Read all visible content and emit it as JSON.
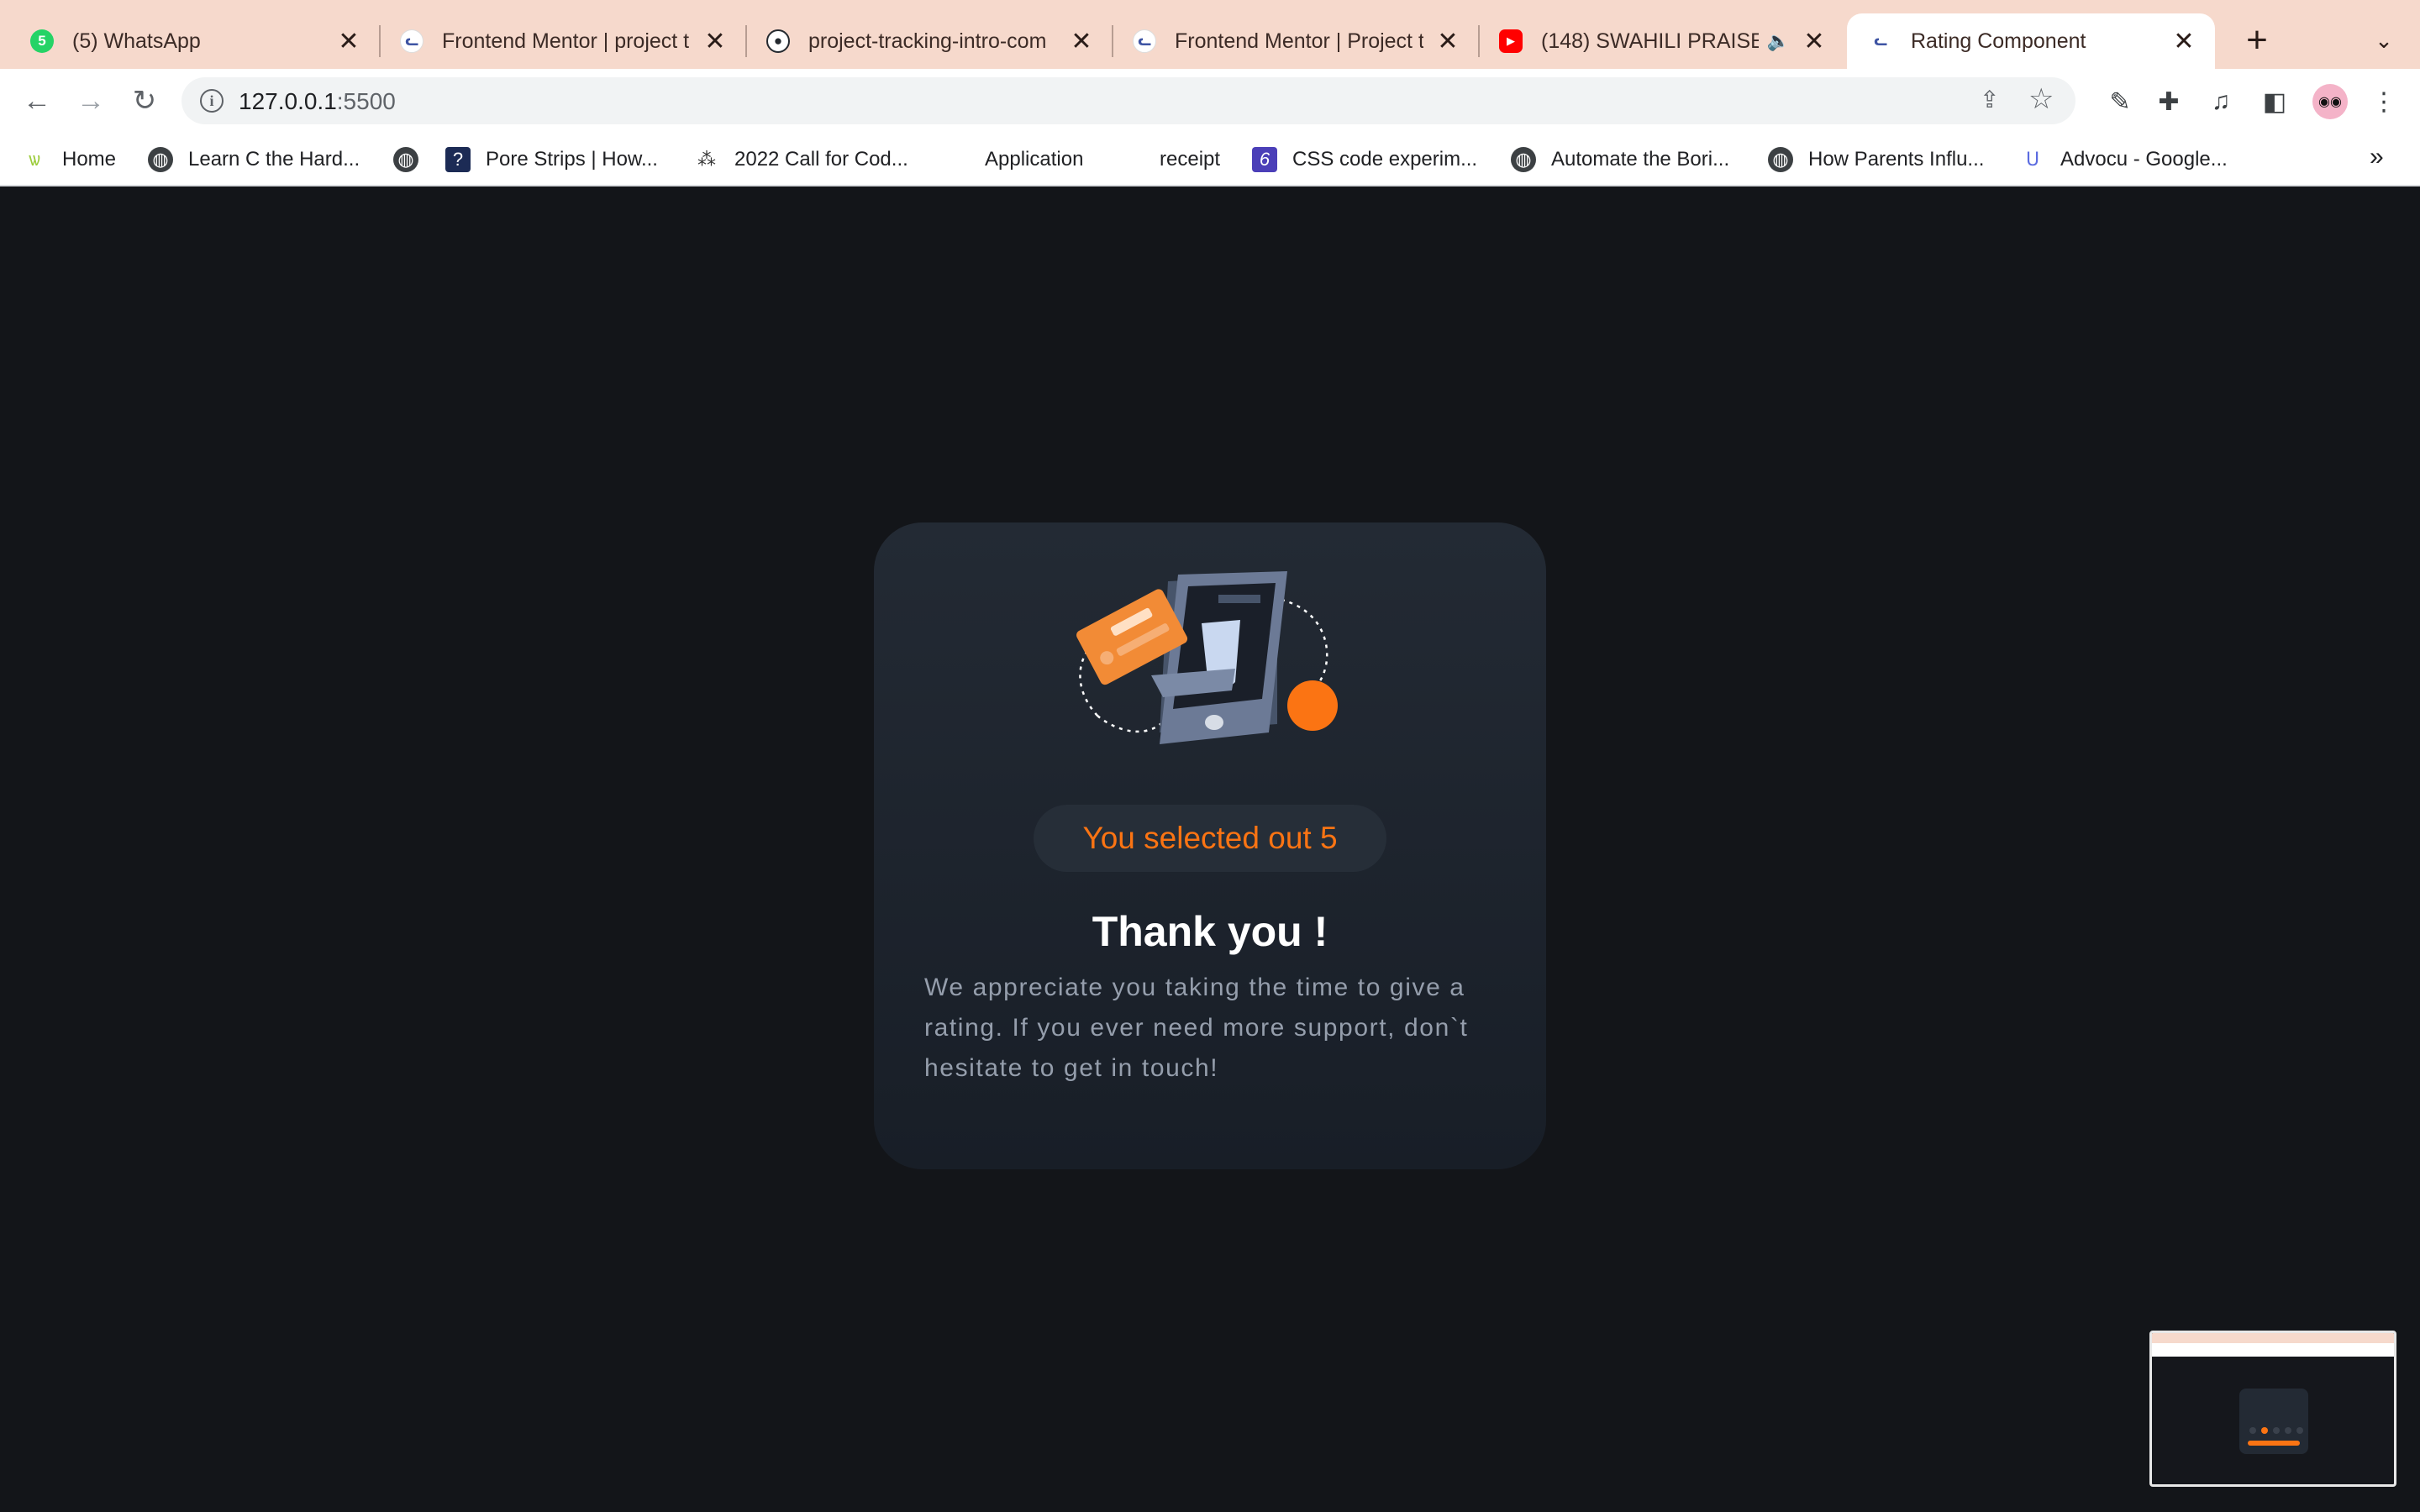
{
  "browser": {
    "tabs": [
      {
        "title": "(5) WhatsApp",
        "favicon": "whatsapp-icon",
        "badge": "5",
        "active": false
      },
      {
        "title": "Frontend Mentor | project t",
        "favicon": "frontend-mentor-icon",
        "active": false
      },
      {
        "title": "project-tracking-intro-com",
        "favicon": "github-icon",
        "active": false
      },
      {
        "title": "Frontend Mentor | Project t",
        "favicon": "frontend-mentor-icon",
        "active": false
      },
      {
        "title": "(148) SWAHILI PRAISE",
        "favicon": "youtube-icon",
        "muted_indicator": "speaker-icon",
        "active": false
      },
      {
        "title": "Rating Component",
        "favicon": "frontend-mentor-icon",
        "active": true
      }
    ],
    "url": {
      "host": "127.0.0.1",
      "port": ":5500"
    },
    "bookmarks": [
      {
        "label": "Home",
        "icon": "wordpress-icon"
      },
      {
        "label": "Learn C the Hard...",
        "icon": "globe-icon"
      },
      {
        "label": "",
        "icon": "globe-icon"
      },
      {
        "label": "Pore Strips | How...",
        "icon": "question-icon"
      },
      {
        "label": "2022 Call for Cod...",
        "icon": "hive-icon"
      },
      {
        "label": "Application",
        "icon": ""
      },
      {
        "label": "receipt",
        "icon": ""
      },
      {
        "label": "CSS code experim...",
        "icon": "six-icon"
      },
      {
        "label": "Automate the Bori...",
        "icon": "globe-icon"
      },
      {
        "label": "How Parents Influ...",
        "icon": "globe-icon"
      },
      {
        "label": "Advocu - Google...",
        "icon": "advocu-icon"
      }
    ],
    "bookmarks_overflow": "»"
  },
  "card": {
    "selection_text": "You selected out 5",
    "heading": "Thank you !",
    "description": "We appreciate you taking the time to give a rating. If you ever need more support, don`t hesitate to get in touch!"
  },
  "colors": {
    "accent": "#fb7413",
    "background": "#131519",
    "card": "#232a34",
    "muted_text": "#959eac",
    "tab_strip": "#f6d9cc"
  }
}
